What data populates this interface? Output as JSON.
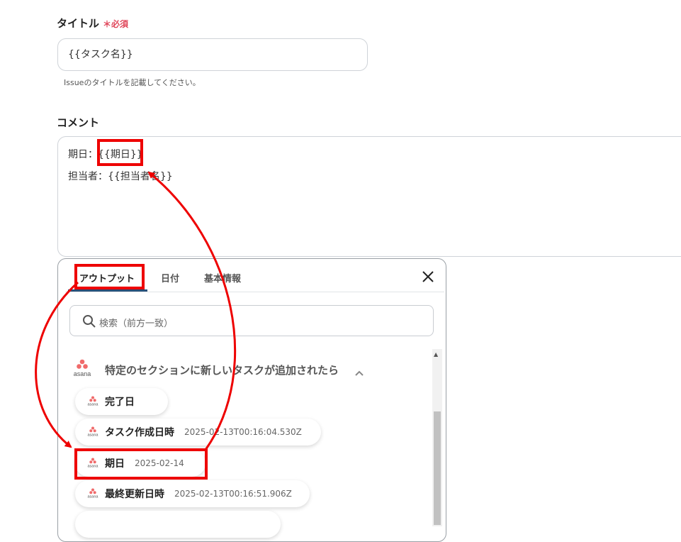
{
  "form": {
    "title_label": "タイトル",
    "required_mark": "＊",
    "required_text": "必須",
    "title_value": "{{タスク名}}",
    "title_help": "Issueのタイトルを記載してください。",
    "comment_label": "コメント",
    "comment_line1_prefix": "期日：",
    "comment_line1_var": "{{期日}}",
    "comment_line2": "担当者：{{担当者名}}"
  },
  "panel": {
    "tabs": [
      {
        "label": "アウトプット"
      },
      {
        "label": "日付"
      },
      {
        "label": "基本情報"
      }
    ],
    "search_placeholder": "検索（前方一致）",
    "group": {
      "app_name": "asana",
      "title": "特定のセクションに新しいタスクが追加されたら"
    },
    "items": [
      {
        "key": "完了日",
        "value": ""
      },
      {
        "key": "タスク作成日時",
        "value": "2025-02-13T00:16:04.530Z"
      },
      {
        "key": "期日",
        "value": "2025-02-14"
      },
      {
        "key": "最終更新日時",
        "value": "2025-02-13T00:16:51.906Z"
      }
    ]
  },
  "colors": {
    "annotation_red": "#ee0000",
    "required_red": "#e0465a",
    "tab_active_underline": "#2a5078",
    "asana_pink": "#f06a6a"
  }
}
